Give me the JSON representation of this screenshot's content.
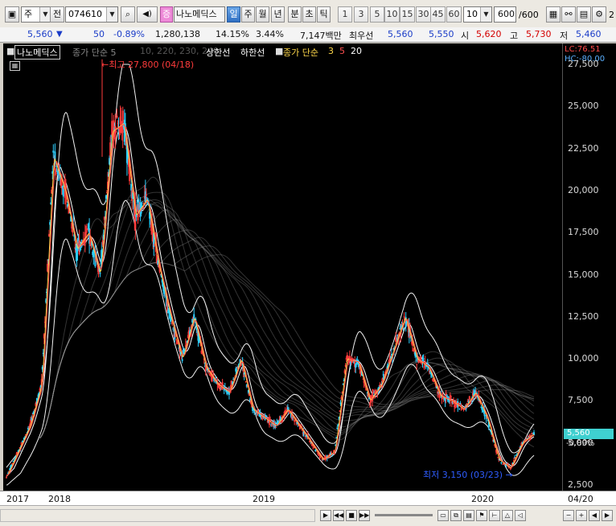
{
  "toolbar": {
    "market_label": "주",
    "prev_label": "전",
    "code": "074610",
    "badge": "증",
    "stock_name": "나노메딕스",
    "period_day": "일",
    "period_week": "주",
    "period_month": "월",
    "period_year": "년",
    "period_minute": "분",
    "period_second": "초",
    "period_tick": "틱",
    "intervals": [
      "1",
      "3",
      "5",
      "10",
      "15",
      "30",
      "45",
      "60"
    ],
    "interval_select": "10",
    "count_value": "600",
    "count_total": "/600",
    "edge_label": "2"
  },
  "quote": {
    "price": "5,560",
    "arrow": "▼",
    "change": "50",
    "change_pct": "-0.89%",
    "volume": "1,280,138",
    "vol_ratio": "14.15%",
    "turnover": "3.44%",
    "amount": "7,147백만",
    "best_ask_label": "최우선",
    "best_ask": "5,560",
    "best_bid": "5,550",
    "open_label": "시",
    "open": "5,620",
    "high_label": "고",
    "high": "5,730",
    "low_label": "저",
    "low": "5,460"
  },
  "legend": {
    "name": "나노메딕스",
    "ma_label": "종가 단순 5",
    "ma_periods": "10, 220, 230, 240",
    "upper_limit": "상한선",
    "lower_limit": "하한선",
    "close_ma": "종가 단순",
    "p3": "3",
    "p5": "5",
    "p20": "20"
  },
  "annotations": {
    "high_note": "최고 27,800 (04/18)",
    "low_note": "최저 3,150 (03/23)"
  },
  "scale": {
    "lc": "LC:76.51",
    "hc": "HC:-80.00",
    "last_price": "5,560",
    "last_pct": "-0.89%"
  },
  "time_axis": [
    "2017",
    "2018",
    "2019",
    "2020",
    "04/20"
  ],
  "colors": {
    "up": "#ff3b3b",
    "down": "#2fd0ff",
    "accent": "#3fd0d0"
  },
  "chart_data": {
    "type": "line",
    "title": "",
    "xlabel": "",
    "ylabel": "",
    "ylim": [
      2500,
      27500
    ],
    "yticks": [
      2500,
      5000,
      7500,
      10000,
      12500,
      15000,
      17500,
      20000,
      22500,
      25000,
      27500
    ],
    "x": [
      "2017",
      "2017",
      "2017",
      "2018",
      "2018",
      "2018",
      "2018",
      "2018",
      "2018",
      "2018",
      "2018",
      "2018",
      "2018",
      "2018",
      "2018",
      "2018",
      "2018",
      "2018",
      "2018",
      "2018",
      "2018",
      "2019",
      "2019",
      "2019",
      "2019",
      "2019",
      "2019",
      "2019",
      "2019",
      "2019",
      "2019",
      "2019",
      "2019",
      "2019",
      "2019",
      "2019",
      "2019",
      "2019",
      "2019",
      "2019",
      "2019",
      "2020",
      "2020",
      "2020",
      "2020",
      "2020"
    ],
    "series": [
      {
        "name": "종가",
        "values": [
          3000,
          4500,
          6000,
          8500,
          22000,
          20000,
          16500,
          17500,
          15000,
          23500,
          24000,
          18500,
          19500,
          15500,
          12500,
          10000,
          12500,
          9500,
          8500,
          8000,
          10000,
          7000,
          6500,
          6000,
          7000,
          6000,
          5000,
          4000,
          4500,
          10000,
          9800,
          7500,
          8500,
          10500,
          12500,
          10000,
          9500,
          7800,
          7500,
          7000,
          8000,
          6500,
          4000,
          3500,
          5000,
          5560
        ]
      }
    ],
    "annotations": [
      {
        "label": "최고 27,800 (04/18)",
        "value": 27800
      },
      {
        "label": "최저 3,150 (03/23)",
        "value": 3150
      }
    ]
  }
}
